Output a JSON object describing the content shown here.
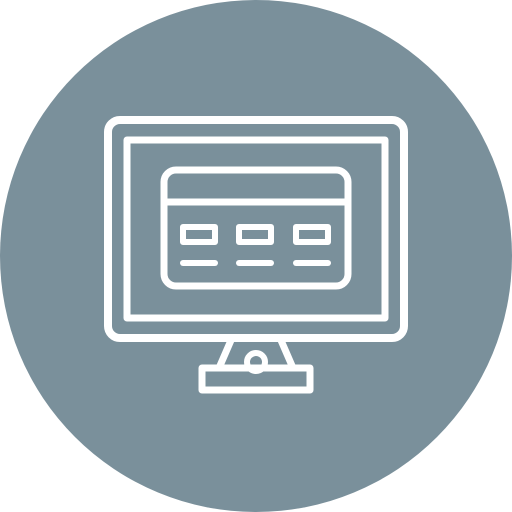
{
  "icon": {
    "name": "desktop-monitor-credit-card-icon",
    "colors": {
      "circle": "#7a909b",
      "line": "#ffffff"
    }
  }
}
